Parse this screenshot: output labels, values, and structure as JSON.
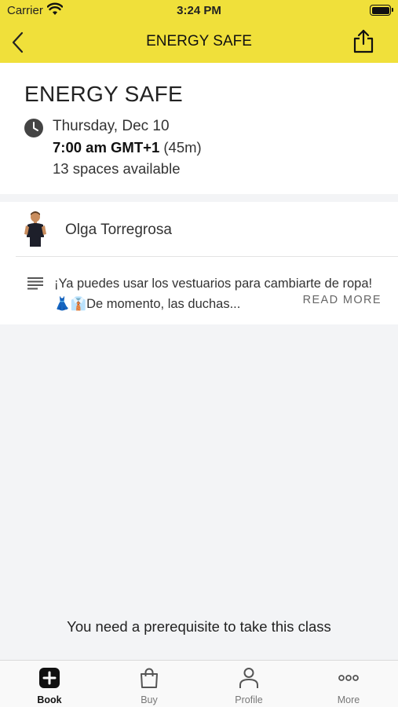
{
  "status_bar": {
    "carrier": "Carrier",
    "time": "3:24 PM"
  },
  "nav": {
    "title": "ENERGY SAFE",
    "back_icon": "chevron-left-icon",
    "share_icon": "share-icon"
  },
  "class_info": {
    "title": "ENERGY SAFE",
    "date": "Thursday, Dec 10",
    "time": "7:00 am GMT+1",
    "duration": "(45m)",
    "spaces": "13 spaces available"
  },
  "instructor": {
    "name": "Olga Torregrosa"
  },
  "description": {
    "text": "¡Ya puedes usar los vestuarios para cambiarte de ropa! 👗👔De momento, las duchas...",
    "read_more": "READ MORE"
  },
  "footer_notice": "You need a prerequisite to take this class",
  "tabs": [
    {
      "label": "Book",
      "icon": "plus-square-icon",
      "active": true
    },
    {
      "label": "Buy",
      "icon": "shopping-bag-icon",
      "active": false
    },
    {
      "label": "Profile",
      "icon": "person-icon",
      "active": false
    },
    {
      "label": "More",
      "icon": "more-dots-icon",
      "active": false
    }
  ],
  "colors": {
    "header": "#f0e03a",
    "background": "#f3f4f6"
  }
}
